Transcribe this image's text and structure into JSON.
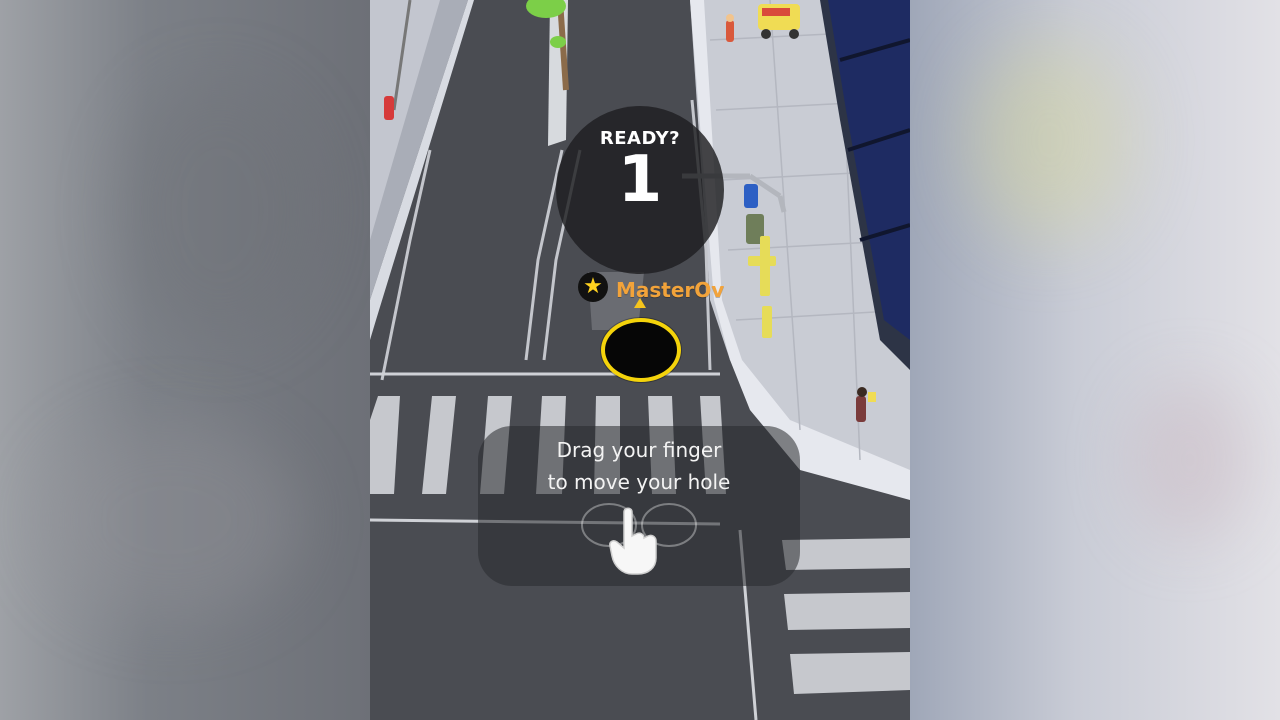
{
  "hud": {
    "ready_label": "READY?",
    "countdown_value": "1"
  },
  "player": {
    "name": "MasterOv",
    "badge_icon": "star-icon",
    "hole_color": "#f4d30b",
    "name_color": "#f2a33a"
  },
  "tutorial": {
    "line1": "Drag your finger",
    "line2": "to move your hole",
    "icon": "pointing-hand-icon"
  }
}
